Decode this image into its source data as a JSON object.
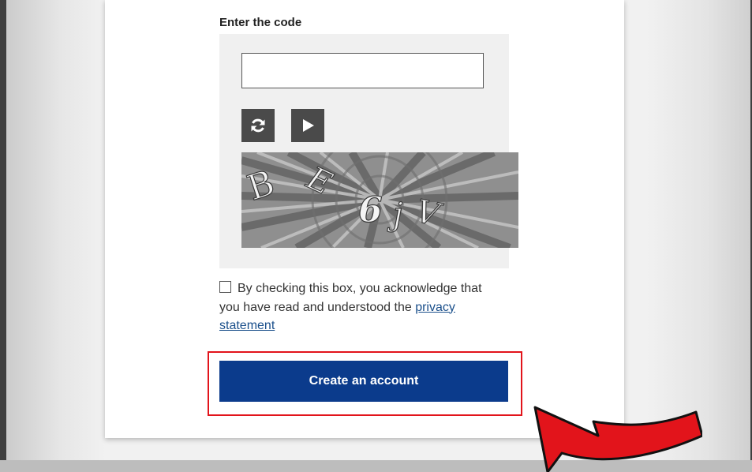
{
  "form": {
    "code_label": "Enter the code",
    "code_input_value": "",
    "captcha_text": "BE6jV",
    "consent_text": "By checking this box, you acknowledge that you have read and understood the",
    "privacy_link": "privacy statement",
    "consent_checked": false,
    "submit_label": "Create an account"
  },
  "icons": {
    "refresh": "refresh-icon",
    "play": "play-icon",
    "checkbox": "checkbox-icon",
    "annotation_arrow": "curved-arrow-icon"
  },
  "colors": {
    "submit_button": "#0b3b8c",
    "link": "#1a4f8b",
    "highlight": "#e2141b",
    "icon_buttons": "#4a4a4a",
    "captcha_bg": "#f0f0f0"
  }
}
